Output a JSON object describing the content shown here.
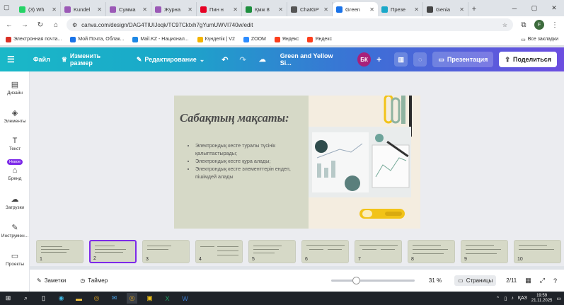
{
  "browser": {
    "tabs": [
      {
        "label": "(3) Wh",
        "color": "#25d366",
        "active": false
      },
      {
        "label": "Kundel",
        "color": "#9b59b6",
        "active": false
      },
      {
        "label": "Сумма",
        "color": "#9b59b6",
        "active": false
      },
      {
        "label": "Журна",
        "color": "#9b59b6",
        "active": false
      },
      {
        "label": "Пин н",
        "color": "#e60023",
        "active": false
      },
      {
        "label": "Қмж 8",
        "color": "#1e8e3e",
        "active": false
      },
      {
        "label": "ChatGP",
        "color": "#555555",
        "active": false
      },
      {
        "label": "Green",
        "color": "#1a73e8",
        "active": true
      },
      {
        "label": "Презе",
        "color": "#1aa8c9",
        "active": false
      },
      {
        "label": "Genia",
        "color": "#444444",
        "active": false
      }
    ],
    "url": "canva.com/design/DAG4TlUIJoqk/TC97Cktxh7gYumUWVI740w/edit",
    "profile_initial": "F",
    "bookmarks": [
      {
        "label": "Электронная почта...",
        "color": "#d93025"
      },
      {
        "label": "Мой Почта, Облак...",
        "color": "#1a73e8"
      },
      {
        "label": "Mail.KZ - Национал...",
        "color": "#1e88e5"
      },
      {
        "label": "Күнделік | V2",
        "color": "#f4b400"
      },
      {
        "label": "ZOOM",
        "color": "#2d8cff"
      },
      {
        "label": "Яндекс",
        "color": "#fc3f1d"
      },
      {
        "label": "Яндекс",
        "color": "#fc3f1d"
      }
    ],
    "all_bookmarks": "Все закладки"
  },
  "canva": {
    "file": "Файл",
    "resize": "Изменить размер",
    "edit": "Редактирование",
    "title": "Green and Yellow Si...",
    "avatar": "БК",
    "present": "Презентация",
    "share": "Поделиться"
  },
  "sidebar": {
    "items": [
      {
        "label": "Дизайн",
        "icon": "layout-icon"
      },
      {
        "label": "Элементы",
        "icon": "shapes-icon"
      },
      {
        "label": "Текст",
        "icon": "text-icon"
      },
      {
        "label": "Бренд",
        "icon": "brand-icon"
      },
      {
        "label": "Загрузки",
        "icon": "cloud-upload-icon"
      },
      {
        "label": "Инструмен...",
        "icon": "tools-icon"
      },
      {
        "label": "Проекты",
        "icon": "folder-icon"
      }
    ],
    "new_badge": "Новое"
  },
  "slide": {
    "title": "Сабақтың мақсаты:",
    "bullets": [
      "Электрондық кесте туралы түсінік қалыптастырады;",
      "Электрондық кесте құра алады;",
      "Электрондық кесте элементтерін ендеп, пішімдей алады"
    ],
    "bg_color": "#d6d9c7",
    "accent_yellow": "#f2c318",
    "accent_green": "#8fb3a0"
  },
  "pages": {
    "thumbs": [
      "1",
      "2",
      "3",
      "4",
      "5",
      "6",
      "7",
      "8",
      "9",
      "10"
    ],
    "active_index": 1
  },
  "bottombar": {
    "notes": "Заметки",
    "timer": "Таймер",
    "zoom": "31 %",
    "pages_label": "Страницы",
    "page_count": "2/11",
    "zoom_level": 0.31
  },
  "taskbar": {
    "lang": "ҚАЗ",
    "time": "19:59",
    "date": "21.11.2025"
  }
}
